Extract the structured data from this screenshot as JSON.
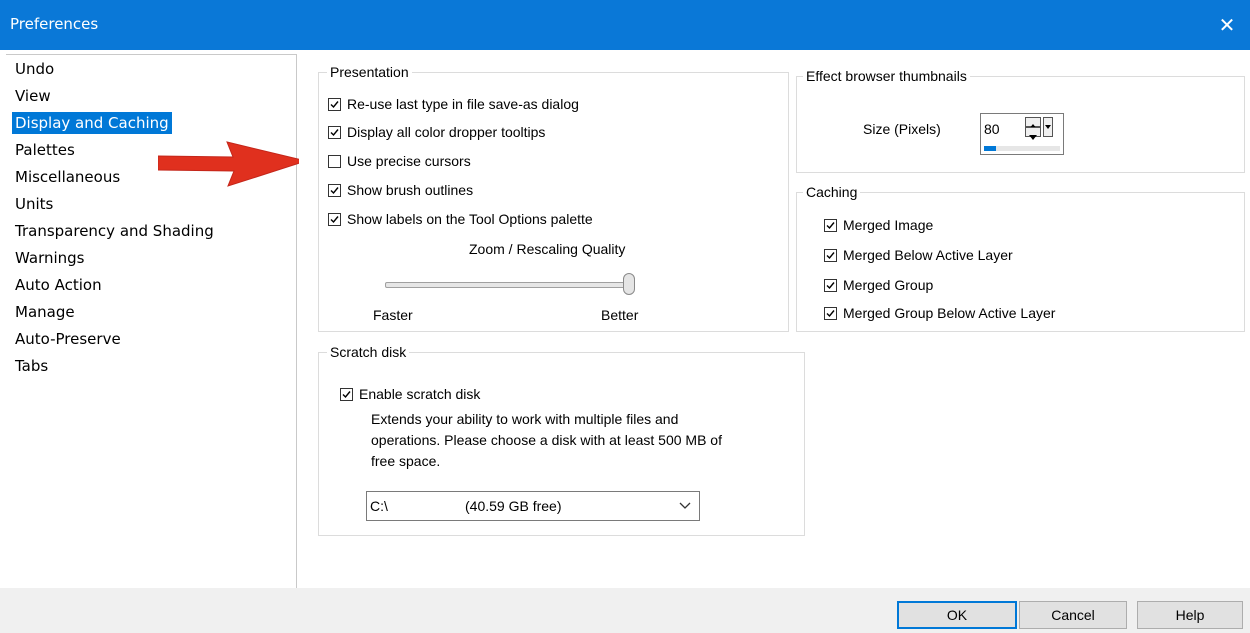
{
  "window": {
    "title": "Preferences",
    "close_glyph": "✕"
  },
  "sidebar": {
    "items": [
      {
        "label": "Undo"
      },
      {
        "label": "View"
      },
      {
        "label": "Display and Caching",
        "selected": true
      },
      {
        "label": "Palettes"
      },
      {
        "label": "Miscellaneous"
      },
      {
        "label": "Units"
      },
      {
        "label": "Transparency and Shading"
      },
      {
        "label": "Warnings"
      },
      {
        "label": "Auto Action"
      },
      {
        "label": "Manage"
      },
      {
        "label": "Auto-Preserve"
      },
      {
        "label": "Tabs"
      }
    ]
  },
  "presentation": {
    "legend": "Presentation",
    "options": [
      {
        "label": "Re-use last type in file save-as dialog",
        "checked": true
      },
      {
        "label": "Display all color dropper tooltips",
        "checked": true
      },
      {
        "label": "Use precise cursors",
        "checked": false
      },
      {
        "label": "Show brush outlines",
        "checked": true
      },
      {
        "label": "Show labels on the Tool Options palette",
        "checked": true
      }
    ],
    "zoom_label": "Zoom / Rescaling Quality",
    "slider_min_label": "Faster",
    "slider_max_label": "Better",
    "slider_value_fraction": 1.0
  },
  "thumbnails": {
    "legend": "Effect browser thumbnails",
    "size_label": "Size (Pixels)",
    "size_value": "80"
  },
  "caching": {
    "legend": "Caching",
    "options": [
      {
        "label": "Merged Image",
        "checked": true
      },
      {
        "label": "Merged Below Active Layer",
        "checked": true
      },
      {
        "label": "Merged Group",
        "checked": true
      },
      {
        "label": "Merged Group Below Active Layer",
        "checked": true
      }
    ]
  },
  "scratch": {
    "legend": "Scratch disk",
    "enable_label": "Enable scratch disk",
    "enable_checked": true,
    "description_lines": [
      "Extends your ability to work with multiple files and",
      "operations. Please choose a disk with at least 500 MB of",
      "free space."
    ],
    "drive": "C:\\",
    "free": "(40.59 GB free)"
  },
  "buttons": {
    "ok": "OK",
    "cancel": "Cancel",
    "help": "Help"
  },
  "colors": {
    "accent": "#0078d7",
    "titlebar": "#0a78d7",
    "annotation_arrow": "#e0301e"
  }
}
